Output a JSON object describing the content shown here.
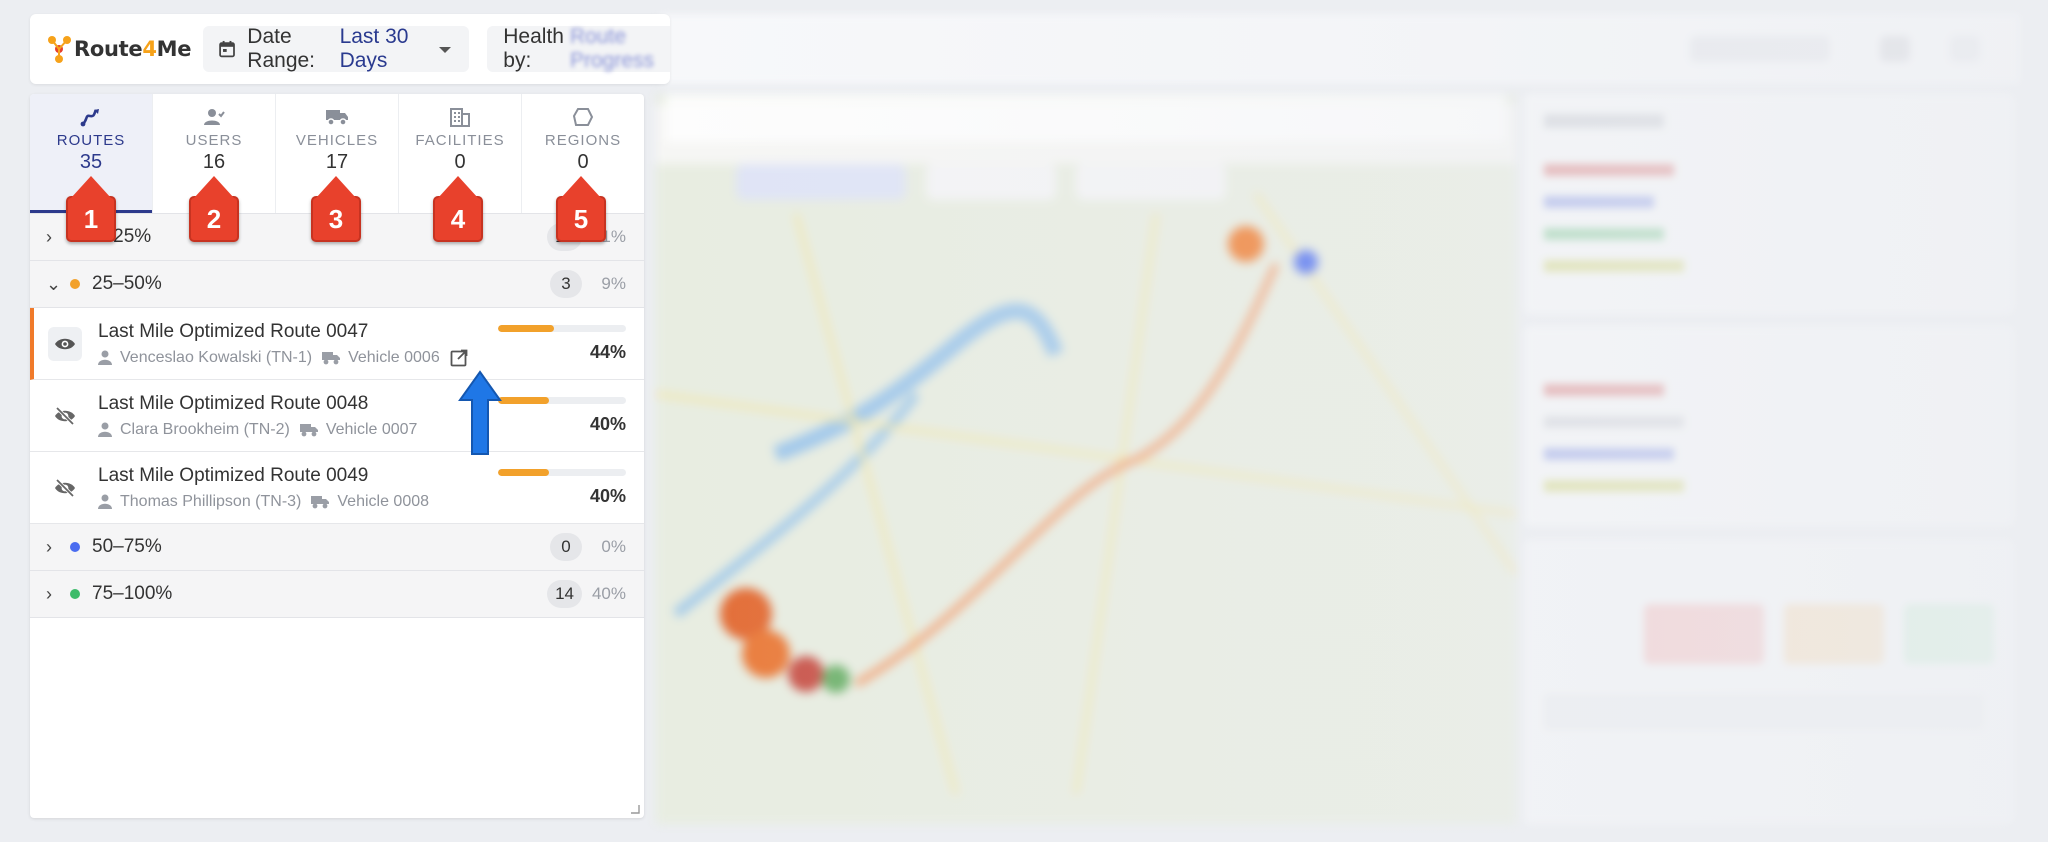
{
  "header": {
    "logo_route": "Route",
    "logo_four": "4",
    "logo_me": "Me",
    "date_range_label": "Date Range:",
    "date_range_value": "Last 30 Days",
    "health_label": "Health by:",
    "health_value": "Route Progress"
  },
  "tabs": [
    {
      "label": "ROUTES",
      "count": "35",
      "icon": "route-icon",
      "active": true
    },
    {
      "label": "USERS",
      "count": "16",
      "icon": "users-icon"
    },
    {
      "label": "VEHICLES",
      "count": "17",
      "icon": "truck-icon"
    },
    {
      "label": "FACILITIES",
      "count": "0",
      "icon": "building-icon"
    },
    {
      "label": "REGIONS",
      "count": "0",
      "icon": "region-icon"
    }
  ],
  "groups": [
    {
      "label": "0–25%",
      "count": "18",
      "pct": "51%",
      "color": "#e8412c",
      "expanded": false
    },
    {
      "label": "25–50%",
      "count": "3",
      "pct": "9%",
      "color": "#f2a12b",
      "expanded": true
    },
    {
      "label": "50–75%",
      "count": "0",
      "pct": "0%",
      "color": "#4a6cf0",
      "expanded": false
    },
    {
      "label": "75–100%",
      "count": "14",
      "pct": "40%",
      "color": "#3dbb6a",
      "expanded": false
    }
  ],
  "routes": [
    {
      "title": "Last Mile Optimized Route 0047",
      "driver": "Venceslao Kowalski (TN-1)",
      "vehicle": "Vehicle 0006",
      "pct": "44%",
      "progress": 0.44,
      "visible": true
    },
    {
      "title": "Last Mile Optimized Route 0048",
      "driver": "Clara Brookheim (TN-2)",
      "vehicle": "Vehicle 0007",
      "pct": "40%",
      "progress": 0.4,
      "visible": false
    },
    {
      "title": "Last Mile Optimized Route 0049",
      "driver": "Thomas Phillipson (TN-3)",
      "vehicle": "Vehicle 0008",
      "pct": "40%",
      "progress": 0.4,
      "visible": false
    }
  ],
  "callouts": [
    "1",
    "2",
    "3",
    "4",
    "5"
  ],
  "colors": {
    "accent": "#2d3a8c",
    "callout": "#e8412c",
    "pointer": "#1f77e6"
  }
}
